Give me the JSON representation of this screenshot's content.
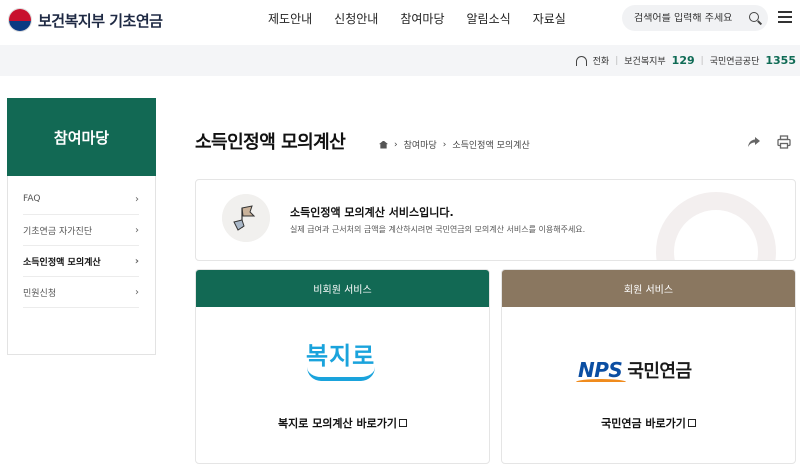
{
  "header": {
    "logo_text": "보건복지부 기초연금",
    "nav": [
      "제도안내",
      "신청안내",
      "참여마당",
      "알림소식",
      "자료실"
    ],
    "search_placeholder": "검색어를 입력해 주세요"
  },
  "utility": {
    "phone_label": "전화",
    "mohw_label": "보건복지부",
    "mohw_number": "129",
    "nps_label": "국민연금공단",
    "nps_number": "1355"
  },
  "sidebar": {
    "title": "참여마당",
    "items": [
      {
        "label": "FAQ",
        "active": false
      },
      {
        "label": "기초연금 자가진단",
        "active": false
      },
      {
        "label": "소득인정액 모의계산",
        "active": true
      },
      {
        "label": "민원신청",
        "active": false
      }
    ]
  },
  "page": {
    "title": "소득인정액 모의계산",
    "breadcrumb": [
      "참여마당",
      "소득인정액 모의계산"
    ]
  },
  "info": {
    "title": "소득인정액 모의계산 서비스입니다.",
    "description": "실제 급여과 근서처의 금액을 계산하시려면 국민연금의 모의계산 서비스를 이용해주세요."
  },
  "cards": [
    {
      "header": "비회원 서비스",
      "header_color": "#126954",
      "logo_text": "복지로",
      "link_label": "복지로 모의계산 바로가기"
    },
    {
      "header": "회원 서비스",
      "header_color": "#8a7760",
      "logo_nps": "NPS",
      "logo_kor": "국민연금",
      "link_label": "국민연금 바로가기"
    }
  ],
  "colors": {
    "brand_green": "#126954",
    "brand_brown": "#8a7760",
    "accent_number": "#0f6b55"
  }
}
